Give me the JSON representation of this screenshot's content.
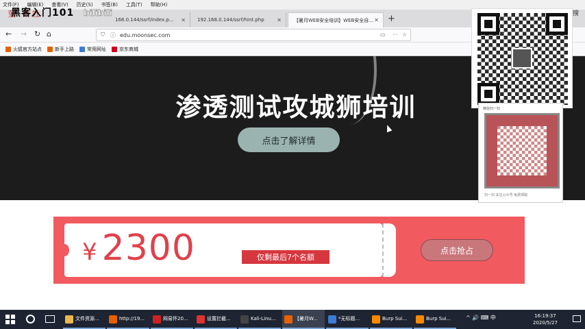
{
  "menubar": [
    "文件(F)",
    "编辑(E)",
    "查看(V)",
    "历史(S)",
    "书签(B)",
    "工具(T)",
    "帮助(H)"
  ],
  "overlay": {
    "title": "黑客入门101",
    "sub": "萤 研社",
    "bili": "bilibili"
  },
  "tabs": [
    {
      "label": "168.0.144/ssrf/index.p..."
    },
    {
      "label": "192.168.0.144/ssrf/hint.php"
    },
    {
      "label": "【暑月WEB安全培训】WEB安全自..."
    }
  ],
  "tab_add": "+",
  "nav": {
    "url": "edu.moonsec.com",
    "back": "←",
    "forward": "→",
    "reload": "↻",
    "home": "⌂"
  },
  "bookmarks": [
    {
      "label": "火狐官方站点",
      "color": "#e66000"
    },
    {
      "label": "新手上路",
      "color": "#e66000"
    },
    {
      "label": "常用网址",
      "color": "#3c7bd6"
    },
    {
      "label": "京东商城",
      "color": "#d0021b"
    }
  ],
  "hero": {
    "title": "渗透测试攻城狮培训",
    "button": "点击了解详情"
  },
  "price": {
    "currency": "¥",
    "amount": "2300",
    "slots": "仅剩最后7个名额",
    "button": "点击抢占"
  },
  "sidepanel": {
    "title": "微信扫一扫",
    "note": "扫一扫 关注公众号 免费领取"
  },
  "side_icon": "搜",
  "taskbar": {
    "items": [
      {
        "label": "文件资源...",
        "color": "#e8b84a"
      },
      {
        "label": "http://19...",
        "color": "#e66000"
      },
      {
        "label": "网易怀20...",
        "color": "#c22"
      },
      {
        "label": "设置拦截...",
        "color": "#d33"
      },
      {
        "label": "Kali-Linu...",
        "color": "#444"
      },
      {
        "label": "【暑月W...",
        "color": "#e66000"
      },
      {
        "label": "*无标题...",
        "color": "#3c7bd6"
      },
      {
        "label": "Burp Sui...",
        "color": "#f80"
      },
      {
        "label": "Burp Sui...",
        "color": "#f80"
      }
    ],
    "tray": "^ 🔊 ⌨ 中",
    "time": "16:19:37",
    "date": "2020/5/27"
  }
}
